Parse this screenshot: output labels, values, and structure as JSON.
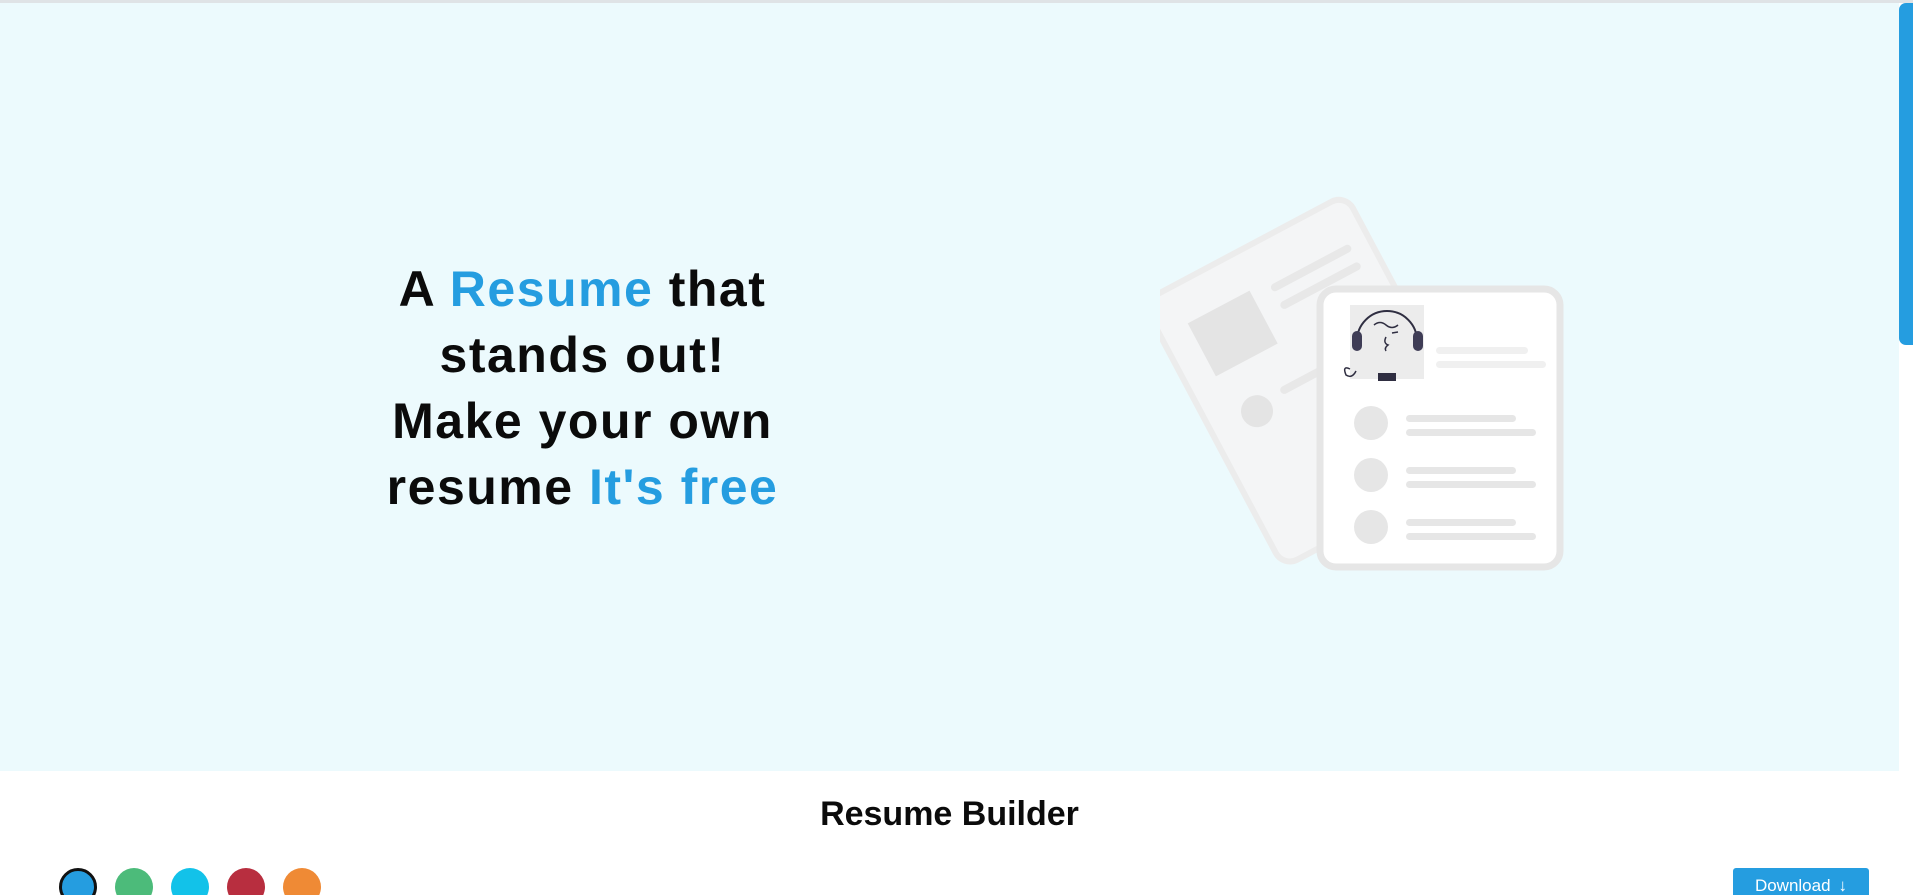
{
  "hero": {
    "line1_a": "A ",
    "line1_accent": "Resume",
    "line1_b": " that",
    "line2": "stands out!",
    "line3": "Make your own",
    "line4_a": "resume ",
    "line4_accent": "It's free"
  },
  "builder": {
    "title": "Resume Builder",
    "download_label": "Download",
    "download_icon": "↓"
  },
  "colors": {
    "accent": "#259de0",
    "hero_bg": "#ecfafd",
    "swatches": [
      "#259de0",
      "#4cbb7a",
      "#12c2e9",
      "#b82e3f",
      "#ef8a35"
    ],
    "selected_swatch": 0
  },
  "icons": {
    "hero_illustration": "resume-illustration-icon",
    "download": "arrow-down-icon"
  }
}
